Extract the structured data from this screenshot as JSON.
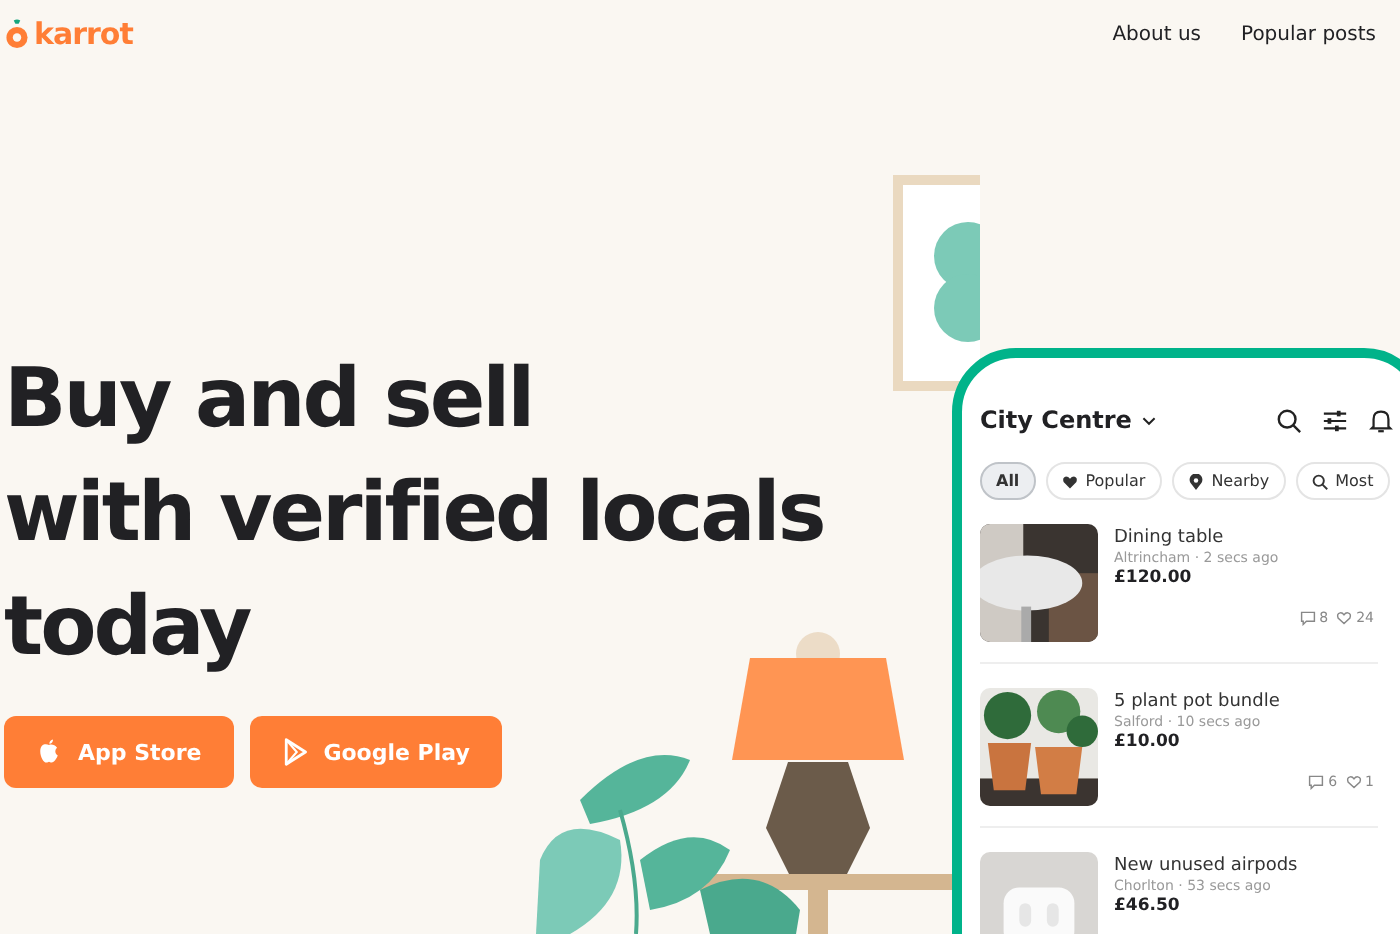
{
  "header": {
    "logo": "karrot",
    "nav": [
      {
        "label": "About us"
      },
      {
        "label": "Popular posts"
      }
    ]
  },
  "hero": {
    "title_lines": [
      "Buy and sell",
      "with verified locals",
      "today"
    ],
    "buttons": [
      {
        "label": "App Store",
        "kind": "apple"
      },
      {
        "label": "Google Play",
        "kind": "google"
      }
    ]
  },
  "phone": {
    "location": "City Centre",
    "chips": [
      {
        "label": "All",
        "selected": true,
        "kind": "none"
      },
      {
        "label": "Popular",
        "selected": false,
        "kind": "heart"
      },
      {
        "label": "Nearby",
        "selected": false,
        "kind": "pin"
      },
      {
        "label": "Most",
        "selected": false,
        "kind": "search"
      }
    ],
    "listings": [
      {
        "title": "Dining table",
        "meta": "Altrincham · 2 secs ago",
        "price": "£120.00",
        "comments": "8",
        "likes": "24",
        "kind": "table"
      },
      {
        "title": "5 plant pot bundle",
        "meta": "Salford · 10 secs ago",
        "price": "£10.00",
        "comments": "6",
        "likes": "1",
        "kind": "plants"
      },
      {
        "title": "New unused airpods",
        "meta": "Chorlton · 53 secs ago",
        "price": "£46.50",
        "kind": "earbuds"
      }
    ]
  }
}
